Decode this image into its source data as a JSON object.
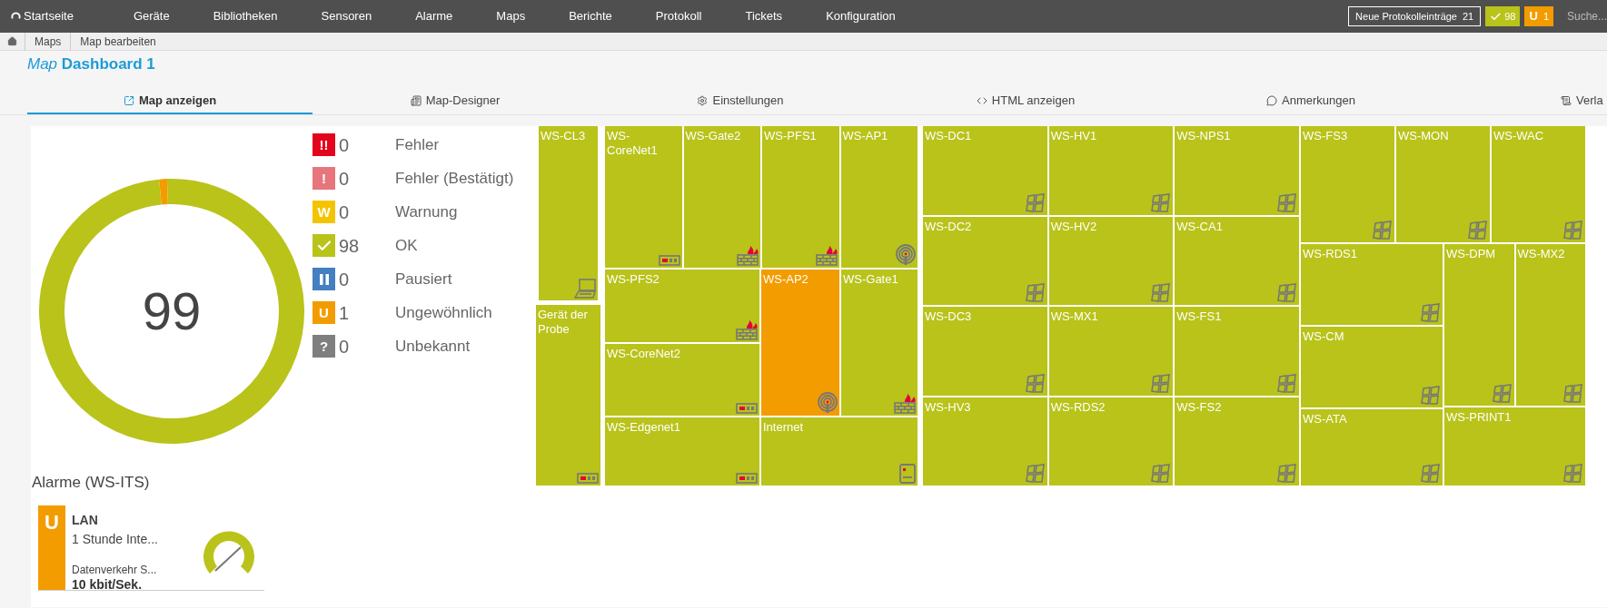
{
  "nav": {
    "items": [
      "Startseite",
      "Geräte",
      "Bibliotheken",
      "Sensoren",
      "Alarme",
      "Maps",
      "Berichte",
      "Protokoll",
      "Tickets",
      "Konfiguration"
    ],
    "log_entries": {
      "label": "Neue Protokolleinträge",
      "count": "21"
    },
    "ok_badge": {
      "count": "98"
    },
    "unusual_badge": {
      "symbol": "U",
      "count": "1"
    },
    "search": {
      "placeholder": "Suche..."
    }
  },
  "breadcrumbs": [
    "Maps",
    "Map bearbeiten"
  ],
  "title": {
    "prefix": "Map",
    "name": "Dashboard 1"
  },
  "tabs": [
    {
      "label": "Map anzeigen",
      "selected": true
    },
    {
      "label": "Map-Designer",
      "selected": false
    },
    {
      "label": "Einstellungen",
      "selected": false
    },
    {
      "label": "HTML anzeigen",
      "selected": false
    },
    {
      "label": "Anmerkungen",
      "selected": false
    },
    {
      "label": "Verla",
      "selected": false
    }
  ],
  "donut": {
    "total": "99"
  },
  "legend": [
    {
      "kind": "error",
      "symbol": "!!",
      "count": "0",
      "label": "Fehler",
      "color": "#e3051b"
    },
    {
      "kind": "error-ack",
      "symbol": "!",
      "count": "0",
      "label": "Fehler (Bestätigt)",
      "color": "#e6767c"
    },
    {
      "kind": "warning",
      "symbol": "W",
      "count": "0",
      "label": "Warnung",
      "color": "#f5c400"
    },
    {
      "kind": "ok",
      "count": "98",
      "label": "OK",
      "color": "#b9c31a"
    },
    {
      "kind": "paused",
      "count": "0",
      "label": "Pausiert",
      "color": "#447fc1"
    },
    {
      "kind": "unusual",
      "symbol": "U",
      "count": "1",
      "label": "Ungewöhnlich",
      "color": "#f39c00"
    },
    {
      "kind": "unknown",
      "symbol": "?",
      "count": "0",
      "label": "Unbekannt",
      "color": "#7f7f7f"
    }
  ],
  "treemap": [
    {
      "name": "WS-CL3",
      "kind": "laptop",
      "color": "#b9c31a"
    },
    {
      "name": "Gerät der Probe",
      "kind": "switch",
      "color": "#b9c31a"
    },
    {
      "name": "WS-CoreNet1",
      "kind": "switch",
      "color": "#b9c31a"
    },
    {
      "name": "WS-Gate2",
      "kind": "firewall",
      "color": "#b9c31a"
    },
    {
      "name": "WS-PFS1",
      "kind": "firewall",
      "color": "#b9c31a"
    },
    {
      "name": "WS-AP1",
      "kind": "access-point",
      "color": "#b9c31a"
    },
    {
      "name": "WS-PFS2",
      "kind": "firewall",
      "color": "#b9c31a"
    },
    {
      "name": "WS-AP2",
      "kind": "access-point",
      "color": "#f39c00"
    },
    {
      "name": "WS-Gate1",
      "kind": "firewall",
      "color": "#b9c31a"
    },
    {
      "name": "WS-CoreNet2",
      "kind": "switch",
      "color": "#b9c31a"
    },
    {
      "name": "WS-Edgenet1",
      "kind": "switch",
      "color": "#b9c31a"
    },
    {
      "name": "Internet",
      "kind": "device",
      "color": "#b9c31a"
    },
    {
      "name": "WS-DC1",
      "kind": "server",
      "color": "#b9c31a"
    },
    {
      "name": "WS-HV1",
      "kind": "server",
      "color": "#b9c31a"
    },
    {
      "name": "WS-NPS1",
      "kind": "server",
      "color": "#b9c31a"
    },
    {
      "name": "WS-DC2",
      "kind": "server",
      "color": "#b9c31a"
    },
    {
      "name": "WS-HV2",
      "kind": "server",
      "color": "#b9c31a"
    },
    {
      "name": "WS-CA1",
      "kind": "server",
      "color": "#b9c31a"
    },
    {
      "name": "WS-DC3",
      "kind": "server",
      "color": "#b9c31a"
    },
    {
      "name": "WS-MX1",
      "kind": "server",
      "color": "#b9c31a"
    },
    {
      "name": "WS-FS1",
      "kind": "server",
      "color": "#b9c31a"
    },
    {
      "name": "WS-HV3",
      "kind": "server",
      "color": "#b9c31a"
    },
    {
      "name": "WS-RDS2",
      "kind": "server",
      "color": "#b9c31a"
    },
    {
      "name": "WS-FS2",
      "kind": "server",
      "color": "#b9c31a"
    },
    {
      "name": "WS-FS3",
      "kind": "server",
      "color": "#b9c31a"
    },
    {
      "name": "WS-MON",
      "kind": "server",
      "color": "#b9c31a"
    },
    {
      "name": "WS-WAC",
      "kind": "server",
      "color": "#b9c31a"
    },
    {
      "name": "WS-RDS1",
      "kind": "server",
      "color": "#b9c31a"
    },
    {
      "name": "WS-DPM",
      "kind": "server",
      "color": "#b9c31a"
    },
    {
      "name": "WS-MX2",
      "kind": "server",
      "color": "#b9c31a"
    },
    {
      "name": "WS-CM",
      "kind": "server",
      "color": "#b9c31a"
    },
    {
      "name": "WS-ATA",
      "kind": "server",
      "color": "#b9c31a"
    },
    {
      "name": "WS-PRINT1",
      "kind": "server",
      "color": "#b9c31a"
    }
  ],
  "alarms": {
    "title": "Alarme (WS-ITS)",
    "items": [
      {
        "symbol": "U",
        "color": "#f39c00",
        "device": "LAN",
        "sensor": "1 Stunde Inte...",
        "channel": "Datenverkehr S...",
        "value": "10 kbit/Sek."
      }
    ]
  }
}
